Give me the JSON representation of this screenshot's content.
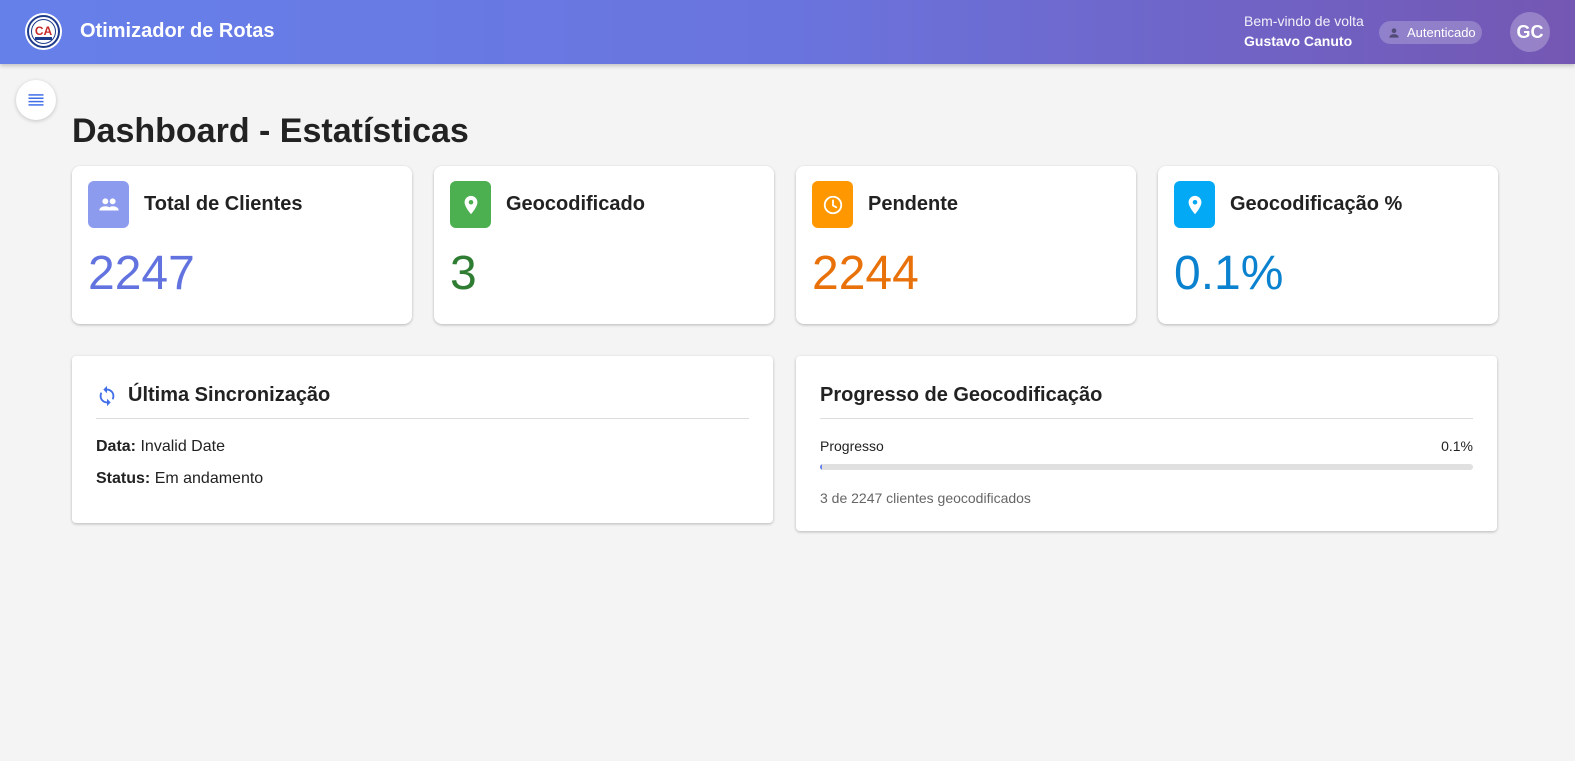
{
  "header": {
    "app_title": "Otimizador de Rotas",
    "logo_text": "CA",
    "welcome_line": "Bem-vindo de volta",
    "user_name": "Gustavo Canuto",
    "auth_status": "Autenticado",
    "avatar_initials": "GC",
    "gradient_colors": [
      "#6680ea",
      "#7457b3"
    ]
  },
  "page": {
    "title": "Dashboard - Estatísticas"
  },
  "stats": [
    {
      "label": "Total de Clientes",
      "value": "2247",
      "icon": "people-icon",
      "icon_bg": "#8c9bee",
      "value_color": "#6273e0"
    },
    {
      "label": "Geocodificado",
      "value": "3",
      "icon": "map-pin-icon",
      "icon_bg": "#4caf50",
      "value_color": "#2e7d32"
    },
    {
      "label": "Pendente",
      "value": "2244",
      "icon": "clock-icon",
      "icon_bg": "#ff9800",
      "value_color": "#e8710a"
    },
    {
      "label": "Geocodificação %",
      "value": "0.1%",
      "icon": "location-pin-icon",
      "icon_bg": "#03a9f4",
      "value_color": "#0a82cf"
    }
  ],
  "sync_panel": {
    "title": "Última Sincronização",
    "icon": "sync-icon",
    "date_label": "Data:",
    "date_value": "Invalid Date",
    "status_label": "Status:",
    "status_value": "Em andamento"
  },
  "progress_panel": {
    "title": "Progresso de Geocodificação",
    "progress_label": "Progresso",
    "progress_pct_text": "0.1%",
    "progress_fraction": 0.001,
    "caption": "3 de 2247 clientes geocodificados"
  }
}
